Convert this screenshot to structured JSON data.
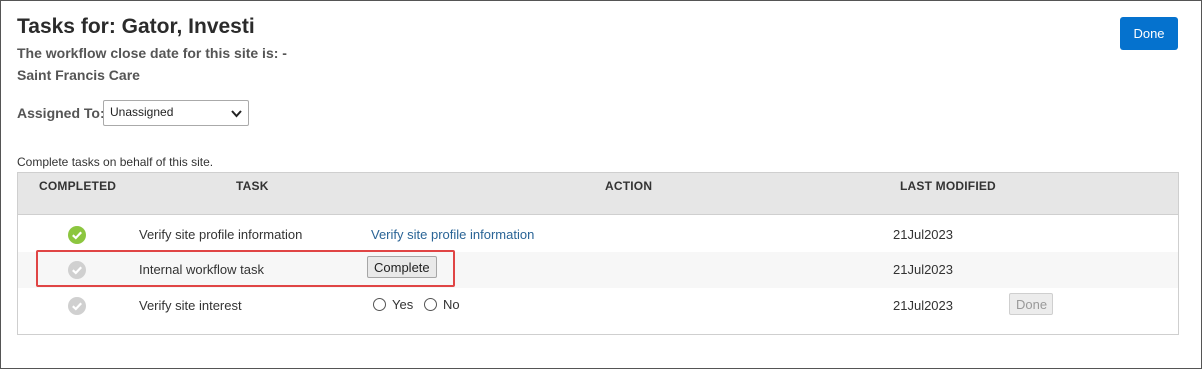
{
  "header": {
    "title": "Tasks for: Gator, Investi",
    "close_date": "The workflow close date for this site is: -",
    "site_name": "Saint Francis Care",
    "done_label": "Done"
  },
  "assigned": {
    "label": "Assigned To:",
    "selected": "Unassigned"
  },
  "caption": "Complete tasks on behalf of this site.",
  "table": {
    "headers": [
      "COMPLETED",
      "TASK",
      "ACTION",
      "LAST MODIFIED"
    ],
    "rows": [
      {
        "completed": true,
        "task": "Verify site profile information",
        "action_link": "Verify site profile information",
        "last_modified": "21Jul2023"
      },
      {
        "completed": false,
        "task": "Internal workflow task",
        "action_button": "Complete",
        "last_modified": "21Jul2023"
      },
      {
        "completed": false,
        "task": "Verify site interest",
        "options": [
          "Yes",
          "No"
        ],
        "last_modified": "21Jul2023",
        "done_label": "Done"
      }
    ]
  },
  "colors": {
    "primary": "#0572ce",
    "check_done": "#8cc63f",
    "check_pending": "#d0d0d0",
    "highlight": "#e04545"
  }
}
